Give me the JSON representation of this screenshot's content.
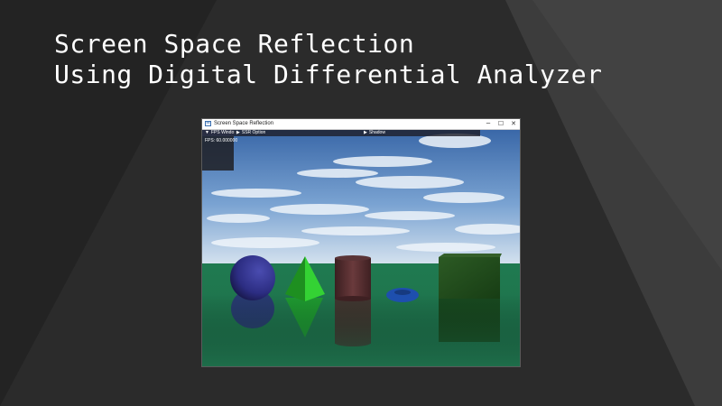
{
  "slide": {
    "title_line1": "Screen Space Reflection",
    "title_line2": "Using Digital Differential Analyzer"
  },
  "window": {
    "title": "Screen Space Reflection",
    "icons": {
      "app": "app-window-icon",
      "minimize": "minimize-icon",
      "maximize": "maximize-icon",
      "close": "close-icon"
    },
    "minimize_glyph": "─",
    "maximize_glyph": "☐",
    "close_glyph": "✕"
  },
  "imgui": {
    "fps_window": {
      "expanded_glyph": "▼",
      "label": "FPS Window",
      "fps_text": "FPS: 60.000000"
    },
    "ssr_option": {
      "collapsed_glyph": "▶",
      "label": "SSR Option"
    },
    "shadow": {
      "collapsed_glyph": "▶",
      "label": "Shadow"
    }
  },
  "scene": {
    "colors": {
      "sky_top": "#3f6fb0",
      "sky_bottom": "#c9dcef",
      "ground": "#207a52",
      "sphere": "#2e2f8a",
      "pyramid": "#27c42a",
      "cylinder": "#5a2f31",
      "torus": "#1f4fb8",
      "cube": "#1f4d1a"
    },
    "objects": [
      "sphere",
      "pyramid",
      "cylinder",
      "torus",
      "cube"
    ]
  }
}
